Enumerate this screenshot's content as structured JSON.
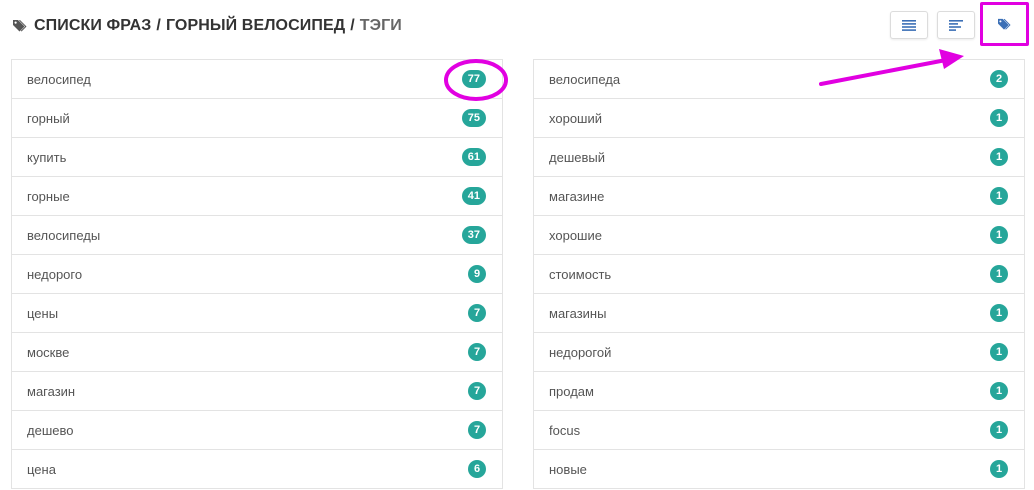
{
  "header": {
    "icon": "tags-icon",
    "breadcrumb": [
      {
        "label": "СПИСКИ ФРАЗ"
      },
      {
        "label": "ГОРНЫЙ ВЕЛОСИПЕД"
      },
      {
        "label": "ТЭГИ"
      }
    ],
    "separator": "/"
  },
  "toolbar": {
    "buttons": [
      {
        "icon": "list-lines-icon"
      },
      {
        "icon": "align-left-icon"
      },
      {
        "icon": "tags-icon",
        "highlighted": true
      }
    ]
  },
  "colors": {
    "badge": "#26a69a",
    "annotation": "#e100e1",
    "border": "#e3e3e3",
    "text": "#555555"
  },
  "left_list": [
    {
      "label": "велосипед",
      "count": "77"
    },
    {
      "label": "горный",
      "count": "75"
    },
    {
      "label": "купить",
      "count": "61"
    },
    {
      "label": "горные",
      "count": "41"
    },
    {
      "label": "велосипеды",
      "count": "37"
    },
    {
      "label": "недорого",
      "count": "9"
    },
    {
      "label": "цены",
      "count": "7"
    },
    {
      "label": "москве",
      "count": "7"
    },
    {
      "label": "магазин",
      "count": "7"
    },
    {
      "label": "дешево",
      "count": "7"
    },
    {
      "label": "цена",
      "count": "6"
    }
  ],
  "right_list": [
    {
      "label": "велосипеда",
      "count": "2"
    },
    {
      "label": "хороший",
      "count": "1"
    },
    {
      "label": "дешевый",
      "count": "1"
    },
    {
      "label": "магазине",
      "count": "1"
    },
    {
      "label": "хорошие",
      "count": "1"
    },
    {
      "label": "стоимость",
      "count": "1"
    },
    {
      "label": "магазины",
      "count": "1"
    },
    {
      "label": "недорогой",
      "count": "1"
    },
    {
      "label": "продам",
      "count": "1"
    },
    {
      "label": "focus",
      "count": "1"
    },
    {
      "label": "новые",
      "count": "1"
    }
  ]
}
